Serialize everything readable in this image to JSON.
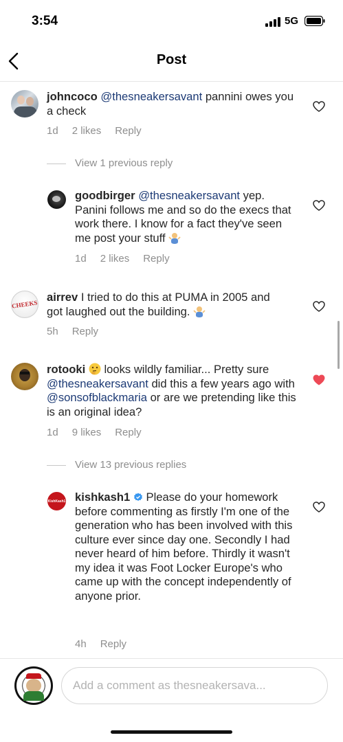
{
  "status_bar": {
    "time": "3:54",
    "network": "5G"
  },
  "header": {
    "title": "Post"
  },
  "comments": [
    {
      "username": "johncoco",
      "mention": "@thesneakersavant",
      "text": " pannini owes you a check",
      "time": "1d",
      "likes": "2 likes",
      "reply": "Reply"
    },
    {
      "view_replies": "View 1 previous reply"
    },
    {
      "username": "goodbirger",
      "mention": "@thesneakersavant",
      "text": " yep. Panini follows me and so do the execs that work there. I know for a fact they've seen me post your stuff",
      "emoji": "person-shrugging-emoji",
      "time": "1d",
      "likes": "2 likes",
      "reply": "Reply"
    },
    {
      "username": "airrev",
      "text": " I tried to do this at PUMA in 2005 and got laughed out the building.",
      "emoji": "person-shrugging-emoji",
      "avatar_text": "CHEEKS",
      "time": "5h",
      "reply": "Reply"
    },
    {
      "username": "rotooki",
      "text_1": " looks wildly familiar... Pretty sure ",
      "mention_1": "@thesneakersavant",
      "text_2": " did this a few years ago with ",
      "mention_2": "@sonsofblackmaria",
      "text_3": " or are we pretending like this is an original idea?",
      "emoji": "thinking-face-emoji",
      "time": "1d",
      "likes": "9 likes",
      "reply": "Reply",
      "liked": true
    },
    {
      "view_replies": "View 13 previous replies"
    },
    {
      "username": "kishkash1",
      "verified": true,
      "avatar_text": "KishKash1",
      "text": " Please do your homework before commenting as firstly I'm one of the generation who has been involved with this culture ever since day one. Secondly I had never heard of him before. Thirdly it wasn't my idea it was Foot Locker Europe's who came up with the concept independently of anyone prior.",
      "time": "4h",
      "reply": "Reply"
    }
  ],
  "composer": {
    "placeholder": "Add a comment as thesneakersava..."
  },
  "colors": {
    "mention": "#1c3a75",
    "liked_heart": "#ed4956",
    "meta": "#8e8e8e"
  }
}
